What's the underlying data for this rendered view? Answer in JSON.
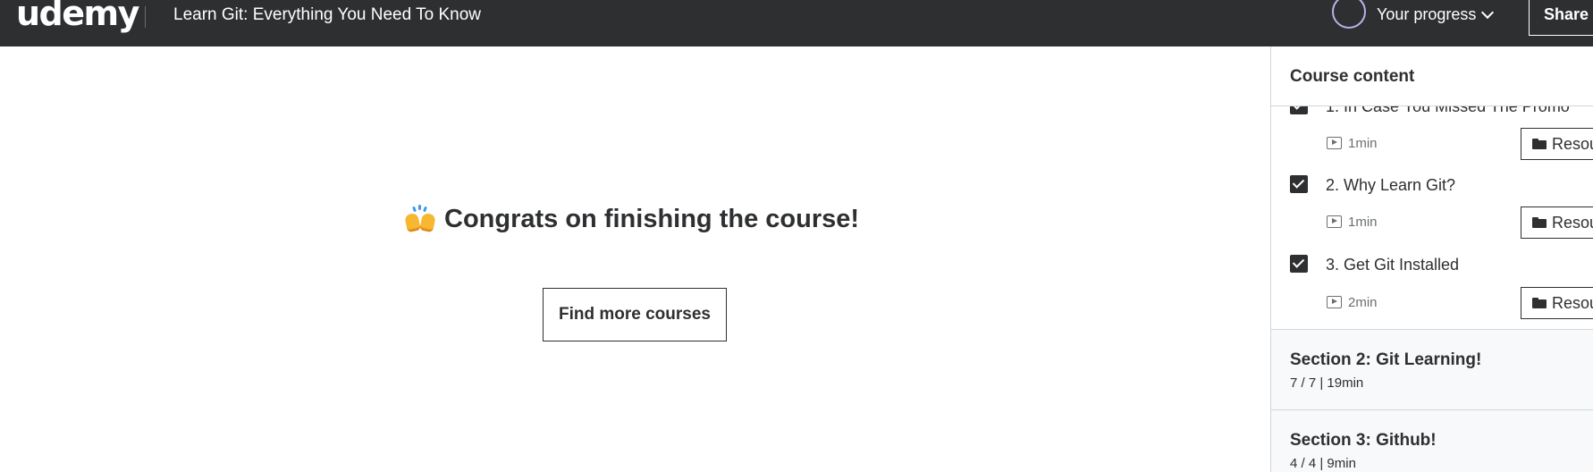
{
  "header": {
    "logo": "udemy",
    "course_title": "Learn Git: Everything You Need To Know",
    "progress_label": "Your progress",
    "share_label": "Share"
  },
  "main": {
    "congrats_text": "Congrats on finishing the course!",
    "find_courses_label": "Find more courses"
  },
  "sidebar": {
    "title": "Course content",
    "lectures": [
      {
        "title": "1. In Case You Missed The Promo",
        "duration": "1min",
        "resources_label": "Resou",
        "checked": true
      },
      {
        "title": "2. Why Learn Git?",
        "duration": "1min",
        "resources_label": "Resou",
        "checked": true
      },
      {
        "title": "3. Get Git Installed",
        "duration": "2min",
        "resources_label": "Resou",
        "checked": true
      }
    ],
    "sections": [
      {
        "title": "Section 2: Git Learning!",
        "meta": "7 / 7 | 19min"
      },
      {
        "title": "Section 3: Github!",
        "meta": "4 / 4 | 9min"
      }
    ]
  },
  "colors": {
    "header_bg": "#2d2f31",
    "brand_purple": "#a435f0",
    "progress_ring": "#b7b2e8",
    "section_bg": "#f7f9fa"
  },
  "icons": [
    "udemy-logo",
    "progress-ring-icon",
    "chevron-down-icon",
    "raising-hands-icon",
    "checkbox-checked-icon",
    "video-icon",
    "folder-icon"
  ]
}
